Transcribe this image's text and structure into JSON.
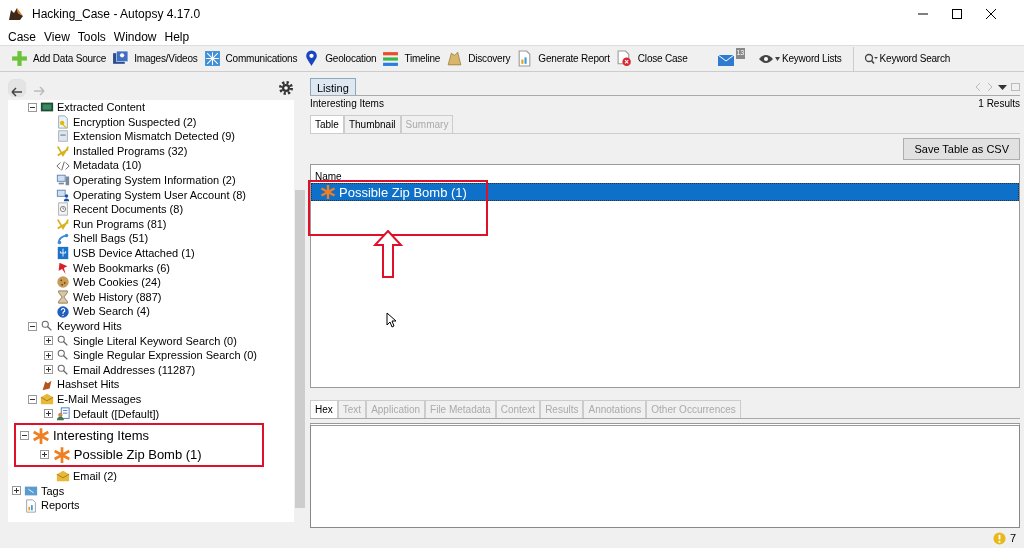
{
  "window": {
    "title": "Hacking_Case - Autopsy 4.17.0"
  },
  "menu": [
    {
      "label": "Case"
    },
    {
      "label": "View"
    },
    {
      "label": "Tools"
    },
    {
      "label": "Window"
    },
    {
      "label": "Help"
    }
  ],
  "toolbar": [
    {
      "label": "Add Data Source",
      "kind": "plus"
    },
    {
      "label": "Images/Videos",
      "kind": "images"
    },
    {
      "label": "Communications",
      "kind": "comms"
    },
    {
      "label": "Geolocation",
      "kind": "pin"
    },
    {
      "label": "Timeline",
      "kind": "timeline"
    },
    {
      "label": "Discovery",
      "kind": "discovery"
    },
    {
      "label": "Generate Report",
      "kind": "report"
    },
    {
      "label": "Close Case",
      "kind": "close"
    }
  ],
  "notifications": {
    "count": "13"
  },
  "keyword_lists": {
    "label": "Keyword Lists"
  },
  "keyword_search": {
    "label": "Keyword Search"
  },
  "tree": {
    "scrolled_branch": [
      {
        "label": "Extracted Content",
        "kind": "folder",
        "expanded": true,
        "children": [
          {
            "label": "Encryption Suspected (2)",
            "kind": "key"
          },
          {
            "label": "Extension Mismatch Detected (9)",
            "kind": "doc"
          },
          {
            "label": "Installed Programs (32)",
            "kind": "program"
          },
          {
            "label": "Metadata (10)",
            "kind": "code"
          },
          {
            "label": "Operating System Information (2)",
            "kind": "computer"
          },
          {
            "label": "Operating System User Account (8)",
            "kind": "user"
          },
          {
            "label": "Recent Documents (8)",
            "kind": "clock"
          },
          {
            "label": "Run Programs (81)",
            "kind": "program"
          },
          {
            "label": "Shell Bags (51)",
            "kind": "shell"
          },
          {
            "label": "USB Device Attached (1)",
            "kind": "usb"
          },
          {
            "label": "Web Bookmarks (6)",
            "kind": "bookmark"
          },
          {
            "label": "Web Cookies (24)",
            "kind": "cookie"
          },
          {
            "label": "Web History (887)",
            "kind": "hourglass"
          },
          {
            "label": "Web Search (4)",
            "kind": "globe"
          }
        ]
      },
      {
        "label": "Keyword Hits",
        "kind": "search",
        "expanded": true,
        "children": [
          {
            "label": "Single Literal Keyword Search (0)",
            "kind": "search",
            "expanded": false
          },
          {
            "label": "Single Regular Expression Search (0)",
            "kind": "search",
            "expanded": false
          },
          {
            "label": "Email Addresses (11287)",
            "kind": "search",
            "expanded": false
          }
        ]
      },
      {
        "label": "Hashset Hits",
        "kind": "hash"
      },
      {
        "label": "E-Mail Messages",
        "kind": "mail",
        "expanded": true,
        "children": [
          {
            "label": "Default ([Default])",
            "kind": "contact",
            "expanded": false
          }
        ]
      },
      {
        "label": "Interesting Items",
        "kind": "asterisk",
        "expanded": true,
        "annotated": true,
        "children": [
          {
            "label": "Possible Zip Bomb (1)",
            "kind": "asterisk",
            "expanded": false
          }
        ]
      },
      {
        "label": "Email (2)",
        "kind": "mail",
        "nested": true
      }
    ],
    "roots": [
      {
        "label": "Tags",
        "kind": "tag",
        "expanded": false
      },
      {
        "label": "Reports",
        "kind": "report"
      }
    ]
  },
  "listing": {
    "tab": "Listing",
    "title": "Interesting Items",
    "results": "1 Results",
    "tabs": [
      {
        "label": "Table",
        "selected": true,
        "disabled": false
      },
      {
        "label": "Thumbnail",
        "selected": false,
        "disabled": false
      },
      {
        "label": "Summary",
        "selected": false,
        "disabled": true
      }
    ],
    "save_button": "Save Table as CSV",
    "columns": [
      "Name"
    ],
    "rows": [
      {
        "name": "Possible Zip Bomb (1)",
        "selected": true,
        "annotated": true
      }
    ]
  },
  "viewer_tabs": [
    {
      "label": "Hex",
      "selected": true,
      "disabled": false
    },
    {
      "label": "Text",
      "selected": false,
      "disabled": true
    },
    {
      "label": "Application",
      "selected": false,
      "disabled": true
    },
    {
      "label": "File Metadata",
      "selected": false,
      "disabled": true
    },
    {
      "label": "Context",
      "selected": false,
      "disabled": true
    },
    {
      "label": "Results",
      "selected": false,
      "disabled": true
    },
    {
      "label": "Annotations",
      "selected": false,
      "disabled": true
    },
    {
      "label": "Other Occurrences",
      "selected": false,
      "disabled": true
    }
  ],
  "status_bar": {
    "notice_count": "7"
  }
}
